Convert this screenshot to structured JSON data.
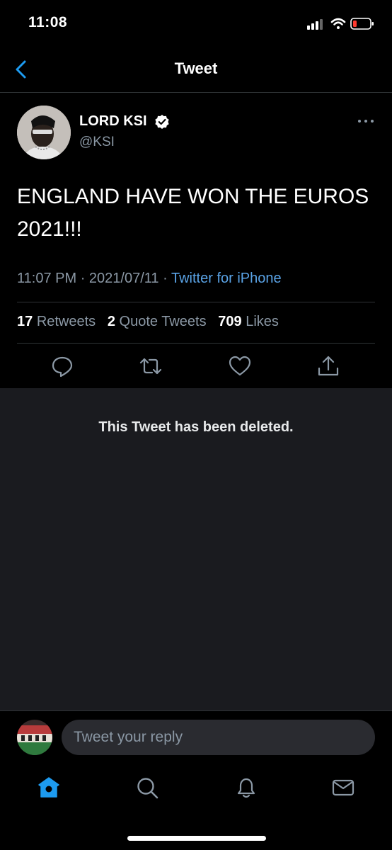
{
  "status_bar": {
    "time": "11:08",
    "icons": [
      "signal-icon",
      "wifi-icon",
      "battery-icon"
    ]
  },
  "nav": {
    "back_icon": "chevron-left-icon",
    "title": "Tweet"
  },
  "tweet": {
    "author_name": "LORD KSI",
    "author_handle": "@KSI",
    "verified": true,
    "text": "ENGLAND HAVE WON THE EUROS 2021!!!",
    "time": "11:07 PM",
    "date": "2021/07/11",
    "separator": "·",
    "source": "Twitter for iPhone",
    "stats": {
      "retweets_count": "17",
      "retweets_label": "Retweets",
      "quotes_count": "2",
      "quotes_label": "Quote Tweets",
      "likes_count": "709",
      "likes_label": "Likes"
    },
    "actions": [
      "reply-icon",
      "retweet-icon",
      "like-icon",
      "share-icon"
    ]
  },
  "deleted_notice": "This Tweet has been deleted.",
  "reply": {
    "placeholder": "Tweet your reply"
  },
  "tab_bar": {
    "items": [
      "home-icon",
      "search-icon",
      "notifications-icon",
      "messages-icon"
    ],
    "active": "home-icon"
  },
  "colors": {
    "accent": "#1d9bf0",
    "link": "#5aa3e6",
    "muted": "#8b98a5",
    "panel": "#1a1b1f",
    "background": "#000000"
  }
}
